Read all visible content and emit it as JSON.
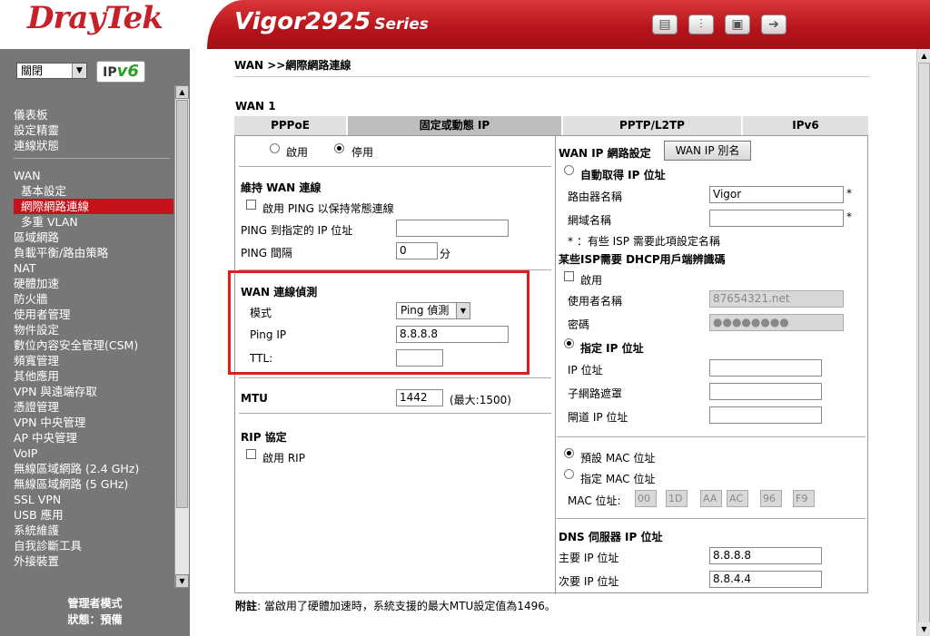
{
  "header": {
    "brand": "DrayTek",
    "model": "Vigor2925",
    "series": "Series",
    "icons": [
      "grid-icon",
      "sliders-icon",
      "save-icon",
      "logout-icon"
    ]
  },
  "sidebar": {
    "language_select": "關閉",
    "ipv6_badge_prefix": "IP",
    "ipv6_badge_suffix": "v6",
    "items": [
      {
        "label": "儀表板"
      },
      {
        "label": "設定精靈"
      },
      {
        "label": "連線狀態"
      },
      {
        "label": "WAN"
      },
      {
        "label": "基本設定"
      },
      {
        "label": "網際網路連線",
        "active": true
      },
      {
        "label": "多重 VLAN"
      },
      {
        "label": "區域網路"
      },
      {
        "label": "負載平衡/路由策略"
      },
      {
        "label": "NAT"
      },
      {
        "label": "硬體加速"
      },
      {
        "label": "防火牆"
      },
      {
        "label": "使用者管理"
      },
      {
        "label": "物件設定"
      },
      {
        "label": "數位內容安全管理(CSM)"
      },
      {
        "label": "頻寬管理"
      },
      {
        "label": "其他應用"
      },
      {
        "label": "VPN 與遠端存取"
      },
      {
        "label": "憑證管理"
      },
      {
        "label": "VPN 中央管理"
      },
      {
        "label": "AP 中央管理"
      },
      {
        "label": "VoIP"
      },
      {
        "label": "無線區域網路 (2.4 GHz)"
      },
      {
        "label": "無線區域網路 (5 GHz)"
      },
      {
        "label": "SSL VPN"
      },
      {
        "label": "USB 應用"
      },
      {
        "label": "系統維護"
      },
      {
        "label": "自我診斷工具"
      },
      {
        "label": "外接裝置"
      }
    ],
    "admin_mode": "管理者模式",
    "status": "狀態：預備"
  },
  "main": {
    "breadcrumb": "WAN >>網際網路連線",
    "section": "WAN 1",
    "tabs": [
      {
        "label": "PPPoE"
      },
      {
        "label": "固定或動態 IP",
        "active": true
      },
      {
        "label": "PPTP/L2TP"
      },
      {
        "label": "IPv6"
      }
    ],
    "left": {
      "enable_label": "啟用",
      "disable_label": "停用",
      "keep_wan_title": "維持 WAN 連線",
      "ping_keep_label": "啟用 PING 以保持常態連線",
      "ping_ip_label": "PING 到指定的 IP 位址",
      "ping_ip_value": "",
      "ping_interval_label": "PING 間隔",
      "ping_interval_value": "0",
      "ping_interval_unit": "分",
      "detect_title": "WAN 連線偵測",
      "mode_label": "模式",
      "mode_value": "Ping 偵測",
      "ping_target_label": "Ping IP",
      "ping_target_value": "8.8.8.8",
      "ttl_label": "TTL:",
      "ttl_value": "",
      "mtu_label": "MTU",
      "mtu_value": "1442",
      "mtu_max": "(最大:1500)",
      "rip_title": "RIP 協定",
      "rip_enable_label": "啟用 RIP"
    },
    "right": {
      "wan_ip_title": "WAN IP 網路設定",
      "alias_button": "WAN IP 別名",
      "auto_ip_label": "自動取得 IP 位址",
      "router_name_label": "路由器名稱",
      "router_name_value": "Vigor",
      "domain_label": "網域名稱",
      "domain_value": "",
      "asterisk": "*",
      "isp_note": "* ：有些 ISP 需要此項設定名稱",
      "dhcp_title": "某些ISP需要 DHCP用戶端辨識碼",
      "dhcp_enable_label": "啟用",
      "username_label": "使用者名稱",
      "username_value": "87654321.net",
      "password_label": "密碼",
      "password_value": "●●●●●●●●",
      "static_ip_label": "指定 IP 位址",
      "ip_label": "IP 位址",
      "ip_value": "",
      "subnet_label": "子網路遮罩",
      "subnet_value": "",
      "gateway_label": "閘道 IP 位址",
      "gateway_value": "",
      "default_mac_label": "預設 MAC 位址",
      "specify_mac_label": "指定 MAC 位址",
      "mac_label": "MAC 位址:",
      "mac_values": [
        "00",
        "1D",
        "AA",
        "AC",
        "96",
        "F9"
      ],
      "dns_title": "DNS 伺服器 IP 位址",
      "dns_primary_label": "主要 IP 位址",
      "dns_primary_value": "8.8.8.8",
      "dns_secondary_label": "次要 IP 位址",
      "dns_secondary_value": "8.8.4.4"
    },
    "note_prefix": "附註",
    "note_text": ": 當啟用了硬體加速時，系統支援的最大MTU設定值為1496。"
  },
  "colors": {
    "brand_red": "#c6212a",
    "active_menu": "#c6101a",
    "highlight": "#e31c1c",
    "sidebar_bg": "#777777"
  }
}
